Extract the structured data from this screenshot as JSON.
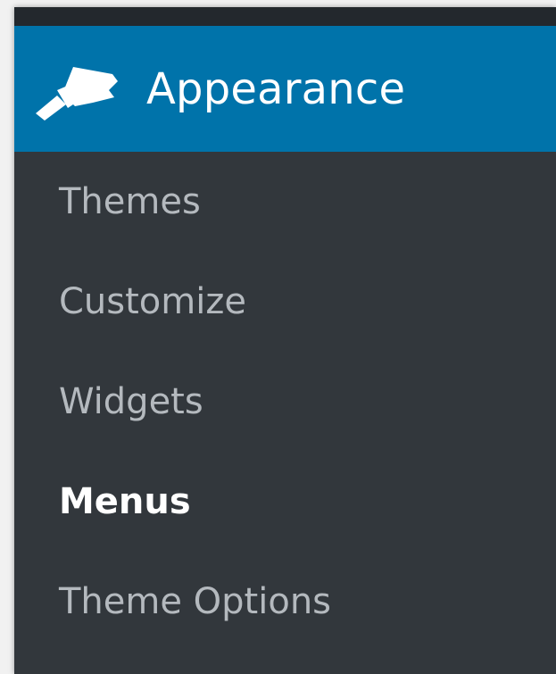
{
  "menu": {
    "header": {
      "label": "Appearance",
      "icon": "paintbrush-icon"
    },
    "items": [
      {
        "label": "Themes",
        "current": false
      },
      {
        "label": "Customize",
        "current": false
      },
      {
        "label": "Widgets",
        "current": false
      },
      {
        "label": "Menus",
        "current": true
      },
      {
        "label": "Theme Options",
        "current": false
      }
    ]
  },
  "colors": {
    "header_bg": "#0073aa",
    "menu_bg": "#32373c",
    "top_strip_bg": "#23282d",
    "item_text": "#b4b9be",
    "current_item_text": "#ffffff"
  }
}
